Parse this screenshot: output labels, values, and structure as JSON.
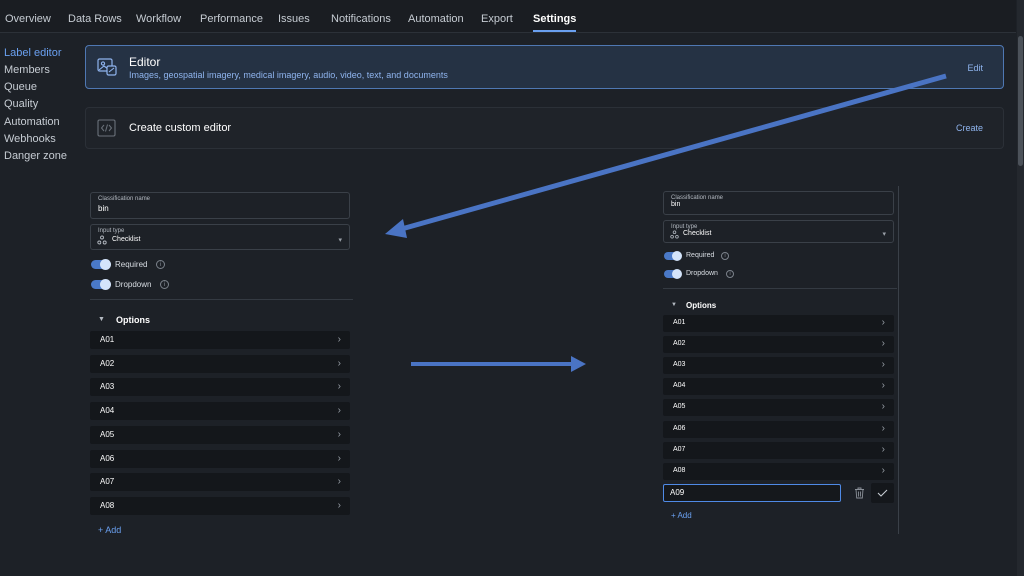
{
  "top_tabs": [
    {
      "label": "Overview"
    },
    {
      "label": "Data Rows"
    },
    {
      "label": "Workflow"
    },
    {
      "label": "Performance"
    },
    {
      "label": "Issues"
    },
    {
      "label": "Notifications"
    },
    {
      "label": "Automation"
    },
    {
      "label": "Export"
    },
    {
      "label": "Settings",
      "active": true
    }
  ],
  "sidebar": {
    "items": [
      {
        "label": "Label editor",
        "active": true
      },
      {
        "label": "Members"
      },
      {
        "label": "Queue"
      },
      {
        "label": "Quality"
      },
      {
        "label": "Automation"
      },
      {
        "label": "Webhooks"
      },
      {
        "label": "Danger zone"
      }
    ]
  },
  "editor_card": {
    "title": "Editor",
    "subtitle": "Images, geospatial imagery, medical imagery, audio, video, text, and documents",
    "action": "Edit"
  },
  "custom_card": {
    "title": "Create custom editor",
    "action": "Create"
  },
  "left_panel": {
    "classification_label": "Classification name",
    "classification_value": "bin",
    "input_type_label": "Input type",
    "input_type_value": "Checklist",
    "required_label": "Required",
    "dropdown_label": "Dropdown",
    "options_heading": "Options",
    "options": [
      "A01",
      "A02",
      "A03",
      "A04",
      "A05",
      "A06",
      "A07",
      "A08"
    ],
    "add_label": "+  Add"
  },
  "right_panel": {
    "classification_label": "Classification name",
    "classification_value": "bin",
    "input_type_label": "Input type",
    "input_type_value": "Checklist",
    "required_label": "Required",
    "dropdown_label": "Dropdown",
    "options_heading": "Options",
    "options": [
      "A01",
      "A02",
      "A03",
      "A04",
      "A05",
      "A06",
      "A07",
      "A08"
    ],
    "new_option_value": "A09",
    "add_label": "+  Add"
  },
  "colors": {
    "accent": "#6aa0f0",
    "arrow": "#4a74c4",
    "background": "#1d2127",
    "row": "#14171b"
  },
  "icons": {
    "editor_card": "image-editor-icon",
    "custom_card": "code-icon",
    "input_type": "checklist-icon",
    "chevron": "chevron-right-icon",
    "delete": "trash-icon",
    "confirm": "check-icon"
  }
}
